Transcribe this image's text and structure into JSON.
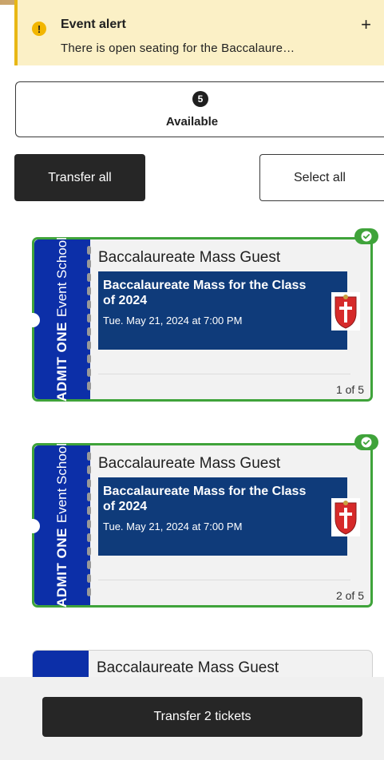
{
  "alert": {
    "title": "Event alert",
    "body": "There is open seating for the Baccalaure…",
    "expand": "+"
  },
  "available": {
    "count": "5",
    "label": "Available"
  },
  "actions": {
    "transfer_all": "Transfer all",
    "select_all": "Select all"
  },
  "tickets": [
    {
      "stub_bold": "ADMIT ONE",
      "stub_sub": "Event School",
      "title": "Baccalaureate Mass Guest",
      "event_name": "Baccalaureate Mass for the Class of 2024",
      "event_date": "Tue. May 21, 2024 at 7:00 PM",
      "index": "1 of 5",
      "selected": true
    },
    {
      "stub_bold": "ADMIT ONE",
      "stub_sub": "Event School",
      "title": "Baccalaureate Mass Guest",
      "event_name": "Baccalaureate Mass for the Class of 2024",
      "event_date": "Tue. May 21, 2024 at 7:00 PM",
      "index": "2 of 5",
      "selected": true
    },
    {
      "title": "Baccalaureate Mass Guest",
      "selected": false
    }
  ],
  "footer": {
    "transfer_button": "Transfer 2 tickets"
  },
  "colors": {
    "selected_border": "#3fa33a",
    "stub": "#0c2fa8",
    "event_box": "#0f3b7a",
    "alert_bg": "#fbf0c6"
  },
  "icons": {
    "alert": "exclamation-circle-icon",
    "check": "check-circle-icon",
    "logo": "school-crest-icon"
  }
}
